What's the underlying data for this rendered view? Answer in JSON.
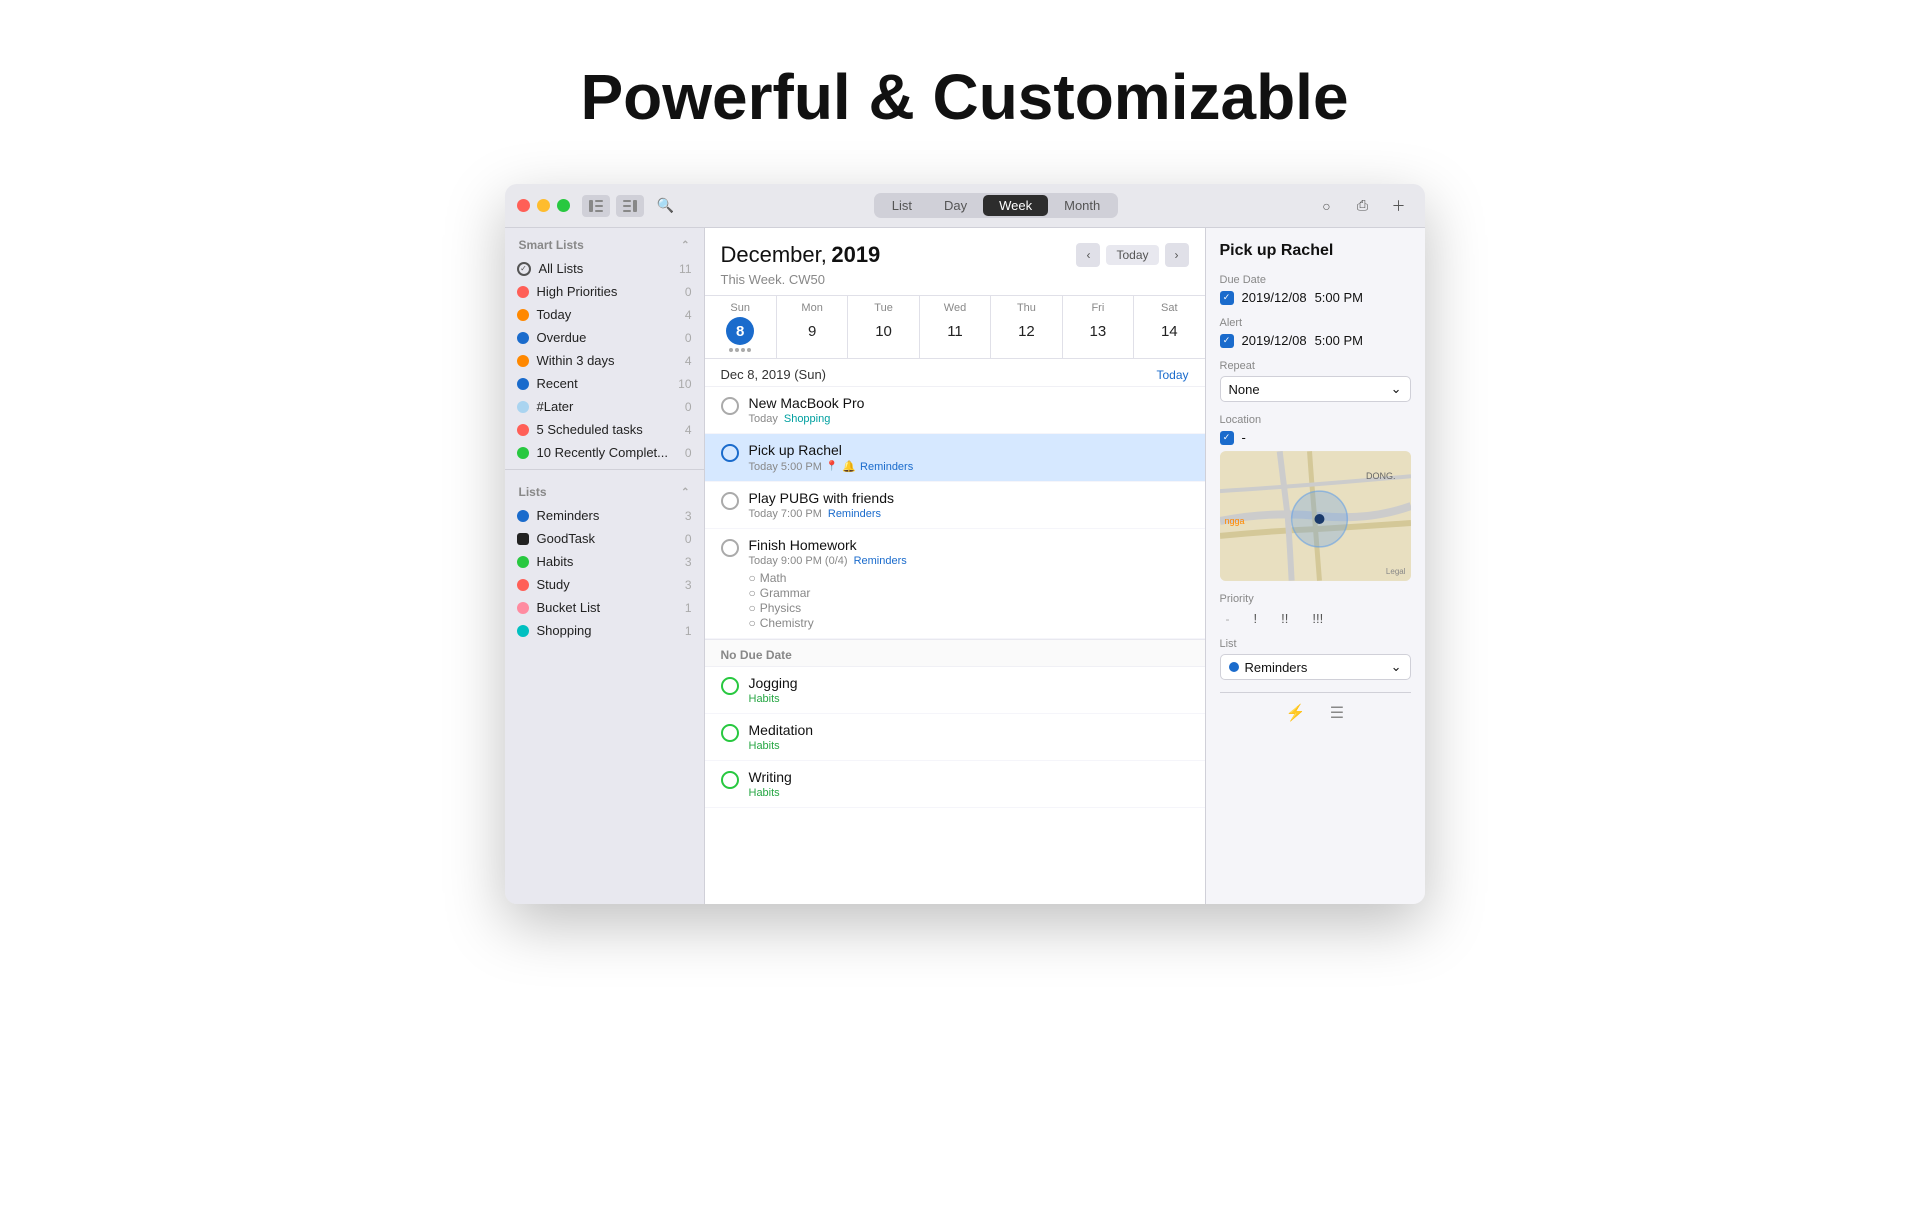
{
  "header": {
    "title": "Powerful & Customizable"
  },
  "titlebar": {
    "tabs": [
      "List",
      "Day",
      "Week",
      "Month"
    ],
    "active_tab": "Week"
  },
  "sidebar": {
    "smart_lists_label": "Smart Lists",
    "lists_label": "Lists",
    "smart_items": [
      {
        "label": "All Lists",
        "count": 11,
        "type": "check",
        "color": "#555"
      },
      {
        "label": "High Priorities",
        "count": 0,
        "type": "dot",
        "color": "#ff5f57"
      },
      {
        "label": "Today",
        "count": 4,
        "type": "dot",
        "color": "#ff8800"
      },
      {
        "label": "Overdue",
        "count": 0,
        "type": "dot",
        "color": "#1a6bcc"
      },
      {
        "label": "Within 3 days",
        "count": 4,
        "type": "dot",
        "color": "#ff8800"
      },
      {
        "label": "Recent",
        "count": 10,
        "type": "dot",
        "color": "#1a6bcc"
      },
      {
        "label": "#Later",
        "count": 0,
        "type": "dot",
        "color": "#aad4f0"
      },
      {
        "label": "5 Scheduled tasks",
        "count": 4,
        "type": "dot",
        "color": "#ff5f57"
      },
      {
        "label": "10 Recently Complet...",
        "count": 0,
        "type": "dot",
        "color": "#28c840"
      }
    ],
    "list_items": [
      {
        "label": "Reminders",
        "count": 3,
        "color": "#1a6bcc"
      },
      {
        "label": "GoodTask",
        "count": 0,
        "color": "#222"
      },
      {
        "label": "Habits",
        "count": 3,
        "color": "#28c840"
      },
      {
        "label": "Study",
        "count": 3,
        "color": "#ff5f57"
      },
      {
        "label": "Bucket List",
        "count": 1,
        "color": "#ff8ba0"
      },
      {
        "label": "Shopping",
        "count": 1,
        "color": "#00c0c0"
      }
    ]
  },
  "calendar": {
    "month": "December,",
    "year": "2019",
    "week_label": "This Week. CW50",
    "days": [
      {
        "name": "Sun",
        "num": "8",
        "today": true
      },
      {
        "name": "Mon",
        "num": "9",
        "today": false
      },
      {
        "name": "Tue",
        "num": "10",
        "today": false
      },
      {
        "name": "Wed",
        "num": "11",
        "today": false
      },
      {
        "name": "Thu",
        "num": "12",
        "today": false
      },
      {
        "name": "Fri",
        "num": "13",
        "today": false
      },
      {
        "name": "Sat",
        "num": "14",
        "today": false
      }
    ],
    "today_nav": "Today"
  },
  "tasks": {
    "date_header": "Dec 8, 2019 (Sun)",
    "today_label": "Today",
    "items": [
      {
        "title": "New MacBook Pro",
        "meta": "Today Shopping",
        "meta_tag": "Shopping",
        "selected": false,
        "subtasks": []
      },
      {
        "title": "Pick up Rachel",
        "meta": "Today 5:00 PM",
        "meta_tag": "Reminders",
        "selected": true,
        "subtasks": []
      },
      {
        "title": "Play PUBG with friends",
        "meta": "Today 7:00 PM",
        "meta_tag": "Reminders",
        "selected": false,
        "subtasks": []
      },
      {
        "title": "Finish Homework",
        "meta": "Today 9:00 PM (0/4)",
        "meta_tag": "Reminders",
        "selected": false,
        "subtasks": [
          "Math",
          "Grammar",
          "Physics",
          "Chemistry"
        ]
      }
    ],
    "no_due_label": "No Due Date",
    "no_due_items": [
      {
        "title": "Jogging",
        "meta_tag": "Habits"
      },
      {
        "title": "Meditation",
        "meta_tag": "Habits"
      },
      {
        "title": "Writing",
        "meta_tag": "Habits"
      }
    ]
  },
  "detail": {
    "title": "Pick up Rachel",
    "due_date_label": "Due Date",
    "due_date_value": "2019/12/08",
    "due_time_value": "5:00 PM",
    "alert_label": "Alert",
    "alert_date": "2019/12/08",
    "alert_time": "5:00 PM",
    "repeat_label": "Repeat",
    "repeat_value": "None",
    "location_label": "Location",
    "location_value": "-",
    "priority_label": "Priority",
    "priority_none": "-",
    "priority_low": "!",
    "priority_med": "!!",
    "priority_high": "!!!",
    "list_label": "List",
    "list_value": "Reminders",
    "map_labels": {
      "dong": "DONG.",
      "ngga": "ngga",
      "legal": "Legal"
    }
  }
}
